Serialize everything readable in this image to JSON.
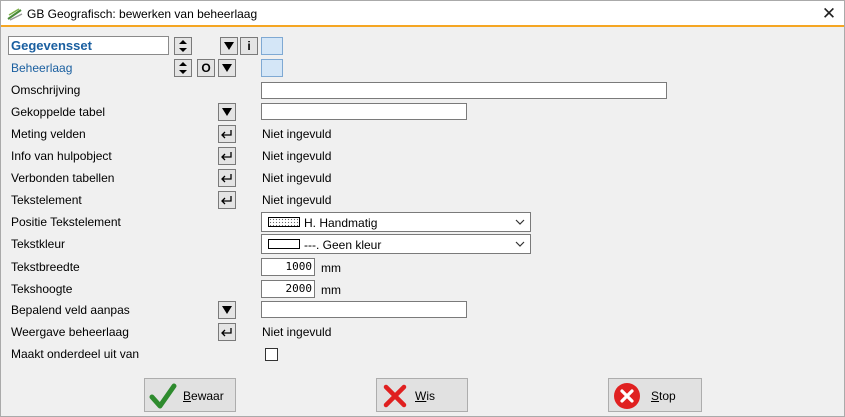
{
  "window": {
    "title": "GB Geografisch: bewerken van beheerlaag"
  },
  "dataset": {
    "value": "Gegevensset"
  },
  "labels": {
    "beheerlaag": "Beheerlaag",
    "omschrijving": "Omschrijving",
    "gekoppelde_tabel": "Gekoppelde tabel",
    "meting_velden": "Meting velden",
    "info_hulpobject": "Info van hulpobject",
    "verbonden_tabellen": "Verbonden tabellen",
    "tekstelement": "Tekstelement",
    "positie_tekstelement": "Positie Tekstelement",
    "tekstkleur": "Tekstkleur",
    "tekstbreedte": "Tekstbreedte",
    "teksthoogte": "Tekshoogte",
    "bepalend_veld": "Bepalend veld aanpas",
    "weergave_beheerlaag": "Weergave beheerlaag",
    "maakt_onderdeel": "Maakt onderdeel uit van"
  },
  "buttons": {
    "info": "i",
    "o": "O"
  },
  "values": {
    "not_filled": "Niet ingevuld",
    "positie_option": "H. Handmatig",
    "tekstkleur_option": "---. Geen kleur",
    "tekstbreedte": "1000",
    "teksthoogte": "2000",
    "unit": "mm"
  },
  "actions": {
    "save_first": "B",
    "save_rest": "ewaar",
    "clear_first": "W",
    "clear_rest": "is",
    "stop_first": "S",
    "stop_rest": "top"
  },
  "colors": {
    "accent": "#f5a623",
    "label_blue": "#1a5fa0",
    "swatch": "#d4e6f7"
  }
}
